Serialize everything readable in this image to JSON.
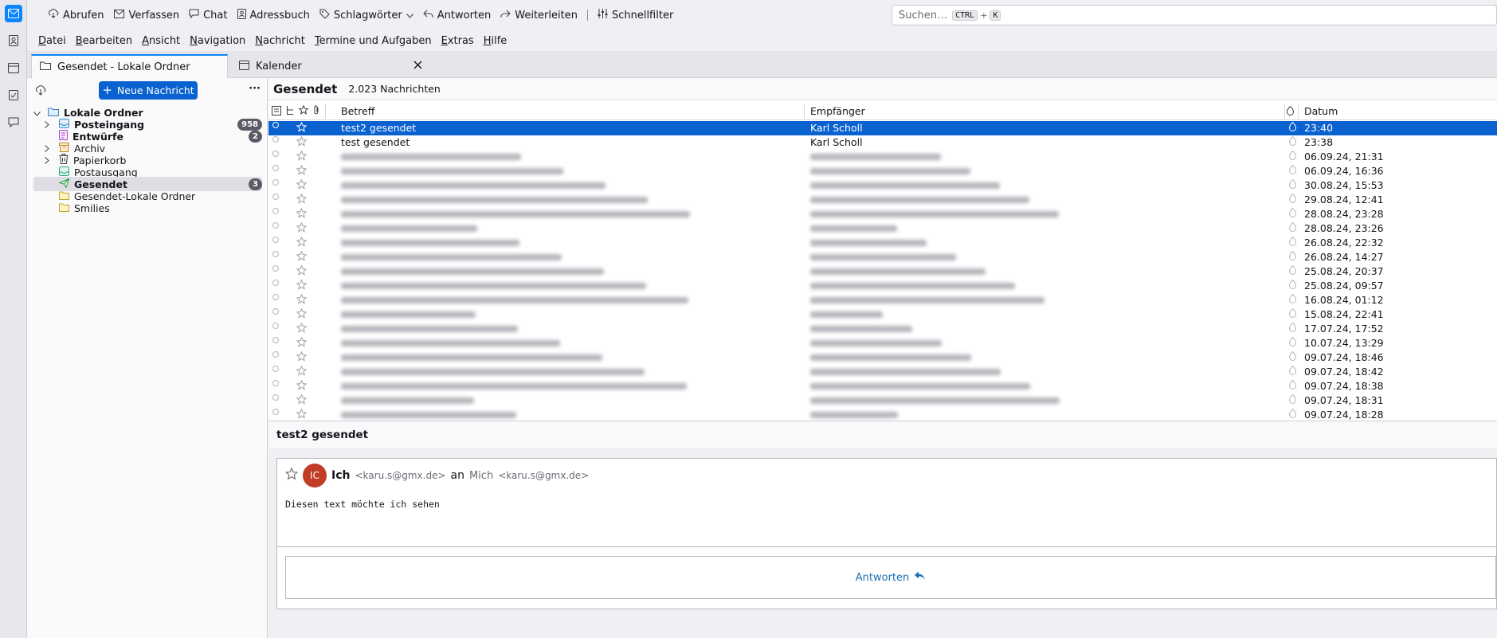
{
  "toolbar": {
    "fetch": "Abrufen",
    "compose": "Verfassen",
    "chat": "Chat",
    "addressbook": "Adressbuch",
    "tags": "Schlagwörter",
    "reply": "Antworten",
    "forward": "Weiterleiten",
    "quickfilter": "Schnellfilter",
    "search_placeholder": "Suchen…",
    "search_key1": "CTRL",
    "search_plus": "+",
    "search_key2": "K"
  },
  "menubar": [
    {
      "first": "D",
      "rest": "atei"
    },
    {
      "first": "B",
      "rest": "earbeiten"
    },
    {
      "first": "A",
      "rest": "nsicht"
    },
    {
      "first": "N",
      "rest": "avigation"
    },
    {
      "first": "N",
      "rest": "achricht"
    },
    {
      "first": "T",
      "rest": "ermine und Aufgaben"
    },
    {
      "first": "E",
      "rest": "xtras"
    },
    {
      "first": "H",
      "rest": "ilfe"
    }
  ],
  "tabs": {
    "mail": "Gesendet - Lokale Ordner",
    "calendar": "Kalender"
  },
  "folderpane": {
    "new_message": "Neue Nachricht",
    "more": "···",
    "account": "Lokale Ordner",
    "folders": [
      {
        "label": "Posteingang",
        "bold": true,
        "badge": "958"
      },
      {
        "label": "Entwürfe",
        "bold": true,
        "badge": "2"
      },
      {
        "label": "Archiv",
        "bold": false,
        "badge": ""
      },
      {
        "label": "Papierkorb",
        "bold": false,
        "badge": ""
      },
      {
        "label": "Postausgang",
        "bold": false,
        "badge": ""
      },
      {
        "label": "Gesendet",
        "bold": true,
        "badge": "3"
      },
      {
        "label": "Gesendet-Lokale Ordner",
        "bold": false,
        "badge": ""
      },
      {
        "label": "Smilies",
        "bold": false,
        "badge": ""
      }
    ]
  },
  "messagelist": {
    "folder_title": "Gesendet",
    "count": "2.023 Nachrichten",
    "col_subject": "Betreff",
    "col_recipient": "Empfänger",
    "col_date": "Datum",
    "rows": [
      {
        "subject": "test2 gesendet",
        "recipient": "Karl Scholl",
        "date": "23:40",
        "blurred": false
      },
      {
        "subject": "test gesendet",
        "recipient": "Karl Scholl",
        "date": "23:38",
        "blurred": false
      },
      {
        "subject": "",
        "recipient": "",
        "date": "06.09.24, 21:31",
        "blurred": true
      },
      {
        "subject": "",
        "recipient": "",
        "date": "06.09.24, 16:36",
        "blurred": true
      },
      {
        "subject": "",
        "recipient": "",
        "date": "30.08.24, 15:53",
        "blurred": true
      },
      {
        "subject": "",
        "recipient": "",
        "date": "29.08.24, 12:41",
        "blurred": true
      },
      {
        "subject": "",
        "recipient": "",
        "date": "28.08.24, 23:28",
        "blurred": true
      },
      {
        "subject": "",
        "recipient": "",
        "date": "28.08.24, 23:26",
        "blurred": true
      },
      {
        "subject": "",
        "recipient": "",
        "date": "26.08.24, 22:32",
        "blurred": true
      },
      {
        "subject": "",
        "recipient": "",
        "date": "26.08.24, 14:27",
        "blurred": true
      },
      {
        "subject": "",
        "recipient": "",
        "date": "25.08.24, 20:37",
        "blurred": true
      },
      {
        "subject": "",
        "recipient": "",
        "date": "25.08.24, 09:57",
        "blurred": true
      },
      {
        "subject": "",
        "recipient": "",
        "date": "16.08.24, 01:12",
        "blurred": true
      },
      {
        "subject": "",
        "recipient": "",
        "date": "15.08.24, 22:41",
        "blurred": true
      },
      {
        "subject": "",
        "recipient": "",
        "date": "17.07.24, 17:52",
        "blurred": true
      },
      {
        "subject": "",
        "recipient": "",
        "date": "10.07.24, 13:29",
        "blurred": true
      },
      {
        "subject": "",
        "recipient": "",
        "date": "09.07.24, 18:46",
        "blurred": true
      },
      {
        "subject": "",
        "recipient": "",
        "date": "09.07.24, 18:42",
        "blurred": true
      },
      {
        "subject": "",
        "recipient": "",
        "date": "09.07.24, 18:38",
        "blurred": true
      },
      {
        "subject": "",
        "recipient": "",
        "date": "09.07.24, 18:31",
        "blurred": true
      },
      {
        "subject": "",
        "recipient": "",
        "date": "09.07.24, 18:28",
        "blurred": true
      }
    ]
  },
  "preview": {
    "subject": "test2 gesendet",
    "avatar_initials": "IC",
    "from_name": "Ich",
    "from_email": "<karu.s@gmx.de>",
    "to_word": "an",
    "to_name": "Mich",
    "to_email": "<karu.s@gmx.de>",
    "body": "Diesen text möchte ich sehen",
    "reply_label": "Antworten"
  },
  "colors": {
    "accent": "#0a84ff",
    "selection": "#0a62d0",
    "avatar": "#c03c25",
    "link": "#1a6fb0"
  }
}
